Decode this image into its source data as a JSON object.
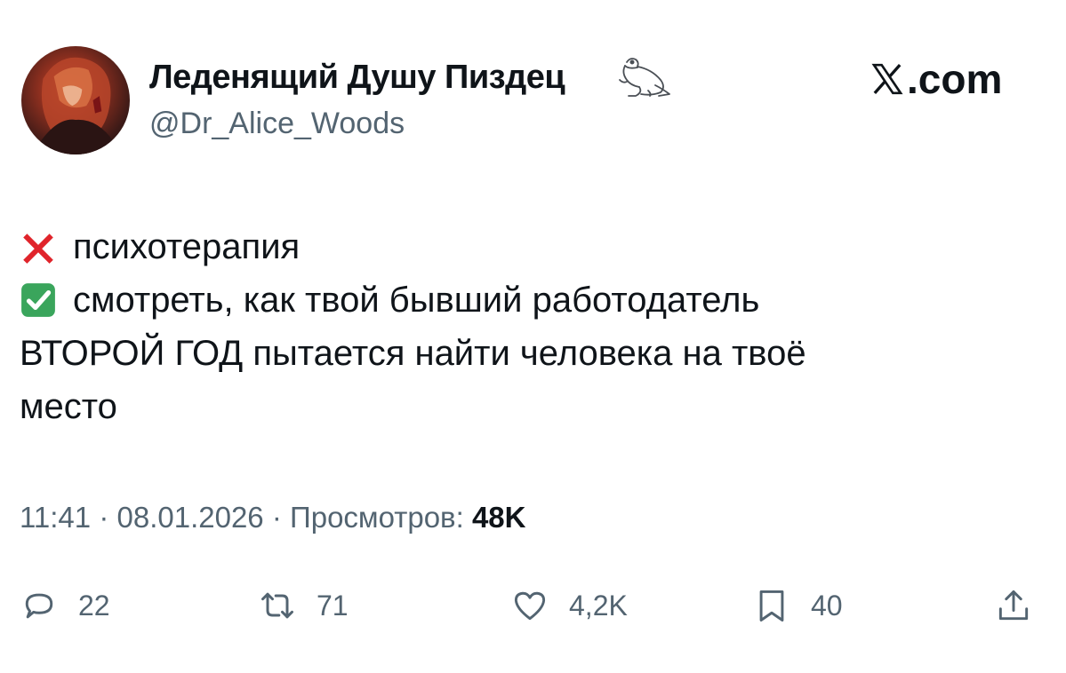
{
  "author": {
    "display_name": "Леденящий Душу Пиздец",
    "handle": "@Dr_Alice_Woods"
  },
  "brand": {
    "logo_text": ".com"
  },
  "tweet": {
    "lines": [
      {
        "emoji": "cross-mark-icon",
        "text": "психотерапия"
      },
      {
        "emoji": "check-mark-icon",
        "text": "смотреть, как твой бывший работодатель"
      },
      {
        "text": "ВТОРОЙ ГОД пытается найти человека на твоё"
      },
      {
        "text": "место"
      }
    ]
  },
  "meta": {
    "time": "11:41",
    "separator": "·",
    "date": "08.01.2026",
    "views_label": "Просмотров:",
    "views_count": "48K"
  },
  "actions": {
    "replies": "22",
    "reposts": "71",
    "likes": "4,2K",
    "bookmarks": "40"
  },
  "colors": {
    "text_primary": "#0f1419",
    "text_secondary": "#536471",
    "cross_red": "#e0242b",
    "check_green": "#3aa55c"
  }
}
